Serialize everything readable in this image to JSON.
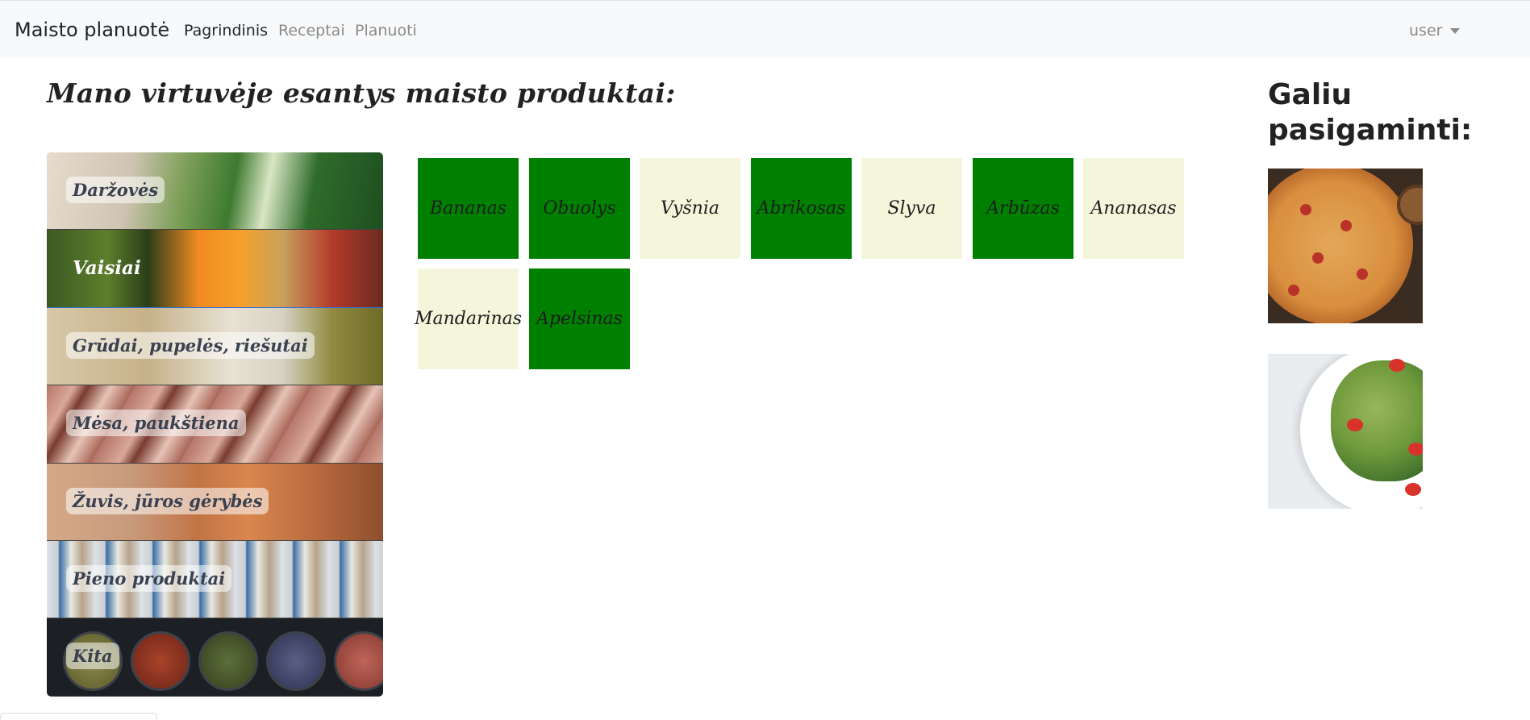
{
  "navbar": {
    "brand": "Maisto planuotė",
    "links": [
      {
        "label": "Pagrindinis",
        "active": true
      },
      {
        "label": "Receptai",
        "active": false
      },
      {
        "label": "Planuoti",
        "active": false
      }
    ],
    "user_label": "user",
    "user_icon": "chevron-down-icon"
  },
  "main_heading": "Mano virtuvėje esantys maisto produktai:",
  "side_heading": "Galiu pasigaminti:",
  "categories": [
    {
      "label": "Daržovės",
      "active": false
    },
    {
      "label": "Vaisiai",
      "active": true
    },
    {
      "label": "Grūdai, pupelės, riešutai",
      "active": false
    },
    {
      "label": "Mėsa, paukštiena",
      "active": false
    },
    {
      "label": "Žuvis, jūros gėrybės",
      "active": false
    },
    {
      "label": "Pieno produktai",
      "active": false
    },
    {
      "label": "Kita",
      "active": false
    }
  ],
  "products": [
    {
      "name": "Bananas",
      "in_kitchen": true
    },
    {
      "name": "Obuolys",
      "in_kitchen": true
    },
    {
      "name": "Vyšnia",
      "in_kitchen": false
    },
    {
      "name": "Abrikosas",
      "in_kitchen": true
    },
    {
      "name": "Slyva",
      "in_kitchen": false
    },
    {
      "name": "Arbūzas",
      "in_kitchen": true
    },
    {
      "name": "Ananasas",
      "in_kitchen": false
    },
    {
      "name": "Mandarinas",
      "in_kitchen": false
    },
    {
      "name": "Apelsinas",
      "in_kitchen": true
    }
  ],
  "colors": {
    "in_kitchen": "#008000",
    "not_in_kitchen": "#f5f5dc",
    "active_category_outline": "#2f6fdf",
    "navbar_bg": "#f8f9fa"
  },
  "recipes": [
    {
      "image": "pizza-image"
    },
    {
      "image": "pasta-salad-image"
    }
  ]
}
